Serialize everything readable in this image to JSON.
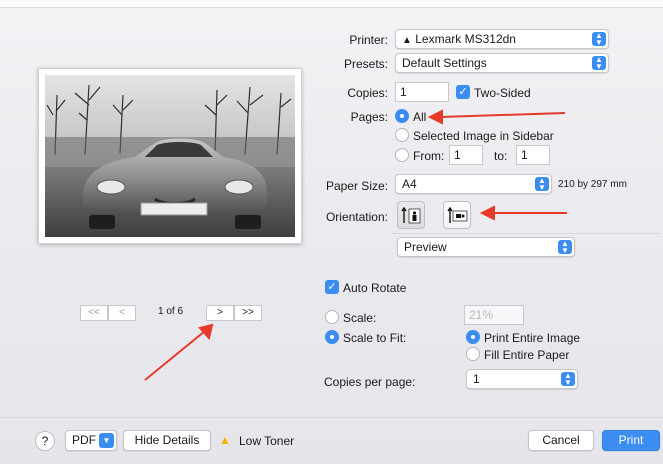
{
  "printer": {
    "label": "Printer:",
    "value": "Lexmark MS312dn"
  },
  "presets": {
    "label": "Presets:",
    "value": "Default Settings"
  },
  "copies": {
    "label": "Copies:",
    "value": "1",
    "two_sided_label": "Two-Sided",
    "two_sided_checked": true
  },
  "pages": {
    "label": "Pages:",
    "options": [
      "All",
      "Selected Image in Sidebar",
      "From:"
    ],
    "selected": "All",
    "from_value": "1",
    "to_label": "to:",
    "to_value": "1"
  },
  "paper_size": {
    "label": "Paper Size:",
    "value": "A4",
    "dimensions": "210 by 297 mm"
  },
  "orientation": {
    "label": "Orientation:",
    "selected": "portrait"
  },
  "section_popup": {
    "value": "Preview"
  },
  "auto_rotate": {
    "label": "Auto Rotate",
    "checked": true
  },
  "scale": {
    "label": "Scale:",
    "value": "21%"
  },
  "scale_to_fit": {
    "label": "Scale to Fit:",
    "options": [
      "Print Entire Image",
      "Fill Entire Paper"
    ],
    "selected": "Print Entire Image"
  },
  "copies_per_page": {
    "label": "Copies per page:",
    "value": "1"
  },
  "paging": {
    "first": "<<",
    "prev": "<",
    "status": "1 of 6",
    "next": ">",
    "last": ">>"
  },
  "bottom": {
    "help": "?",
    "pdf": "PDF",
    "hide_details": "Hide Details",
    "low_toner": "Low Toner",
    "cancel": "Cancel",
    "print": "Print"
  },
  "colors": {
    "accent": "#3b8df2",
    "arrow": "#e53a2a",
    "warning": "#f2b400"
  }
}
